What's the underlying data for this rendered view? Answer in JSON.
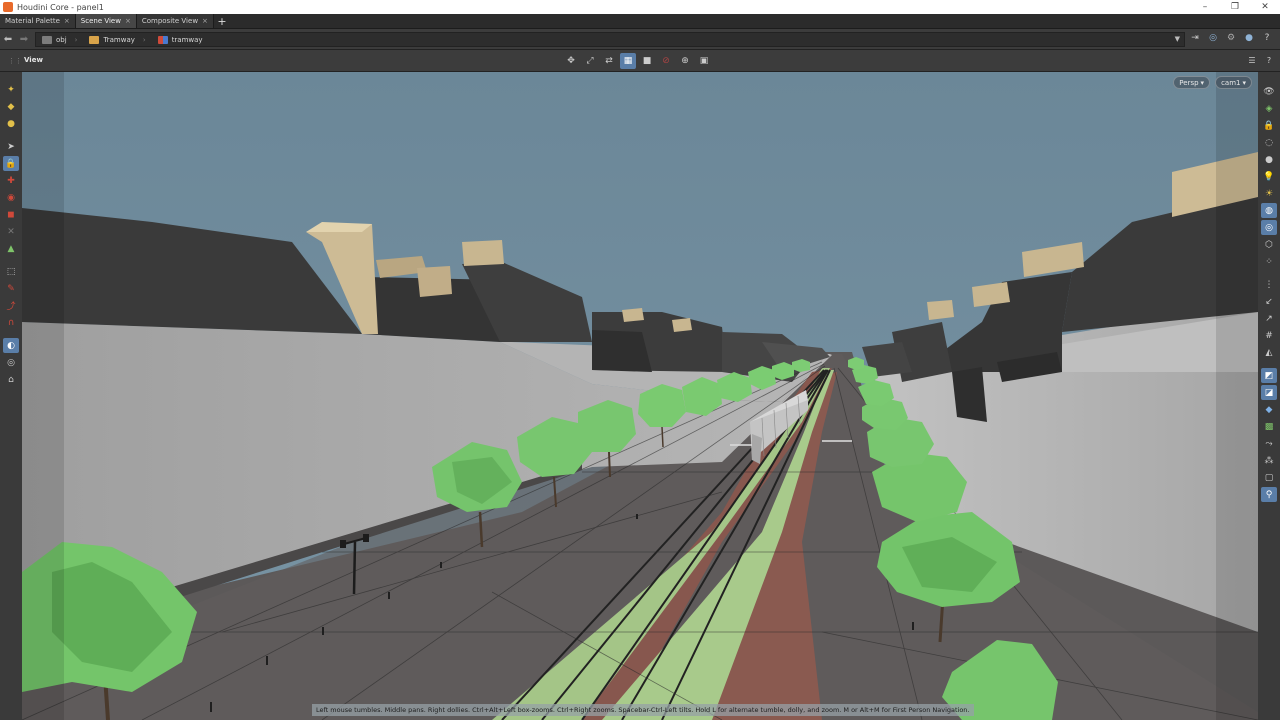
{
  "window": {
    "title": "Houdini Core - panel1",
    "controls": [
      "–",
      "❐",
      "✕"
    ]
  },
  "tabs": [
    {
      "label": "Material Palette",
      "active": false
    },
    {
      "label": "Scene View",
      "active": true
    },
    {
      "label": "Composite View",
      "active": false
    }
  ],
  "path": {
    "crumbs": [
      {
        "label": "obj",
        "icon": "obj-network-icon"
      },
      {
        "label": "Tramway",
        "icon": "folder-icon"
      },
      {
        "label": "tramway",
        "icon": "geometry-node-icon"
      }
    ]
  },
  "pane": {
    "title": "View"
  },
  "viewport": {
    "camera_mode": "Persp",
    "camera_name": "cam1",
    "status_hint": "Left mouse tumbles. Middle pans. Right dollies. Ctrl+Alt+Left box-zooms. Ctrl+Right zooms. Spacebar-Ctrl-Left tilts. Hold L for alternate tumble, dolly, and zoom.      M or Alt+M for First Person Navigation."
  },
  "colors": {
    "sky": "#6e8a9c",
    "accent": "#5a7ea8",
    "wall": "#a9a9a9",
    "roof": "#3b3b3b",
    "ground": "#5e5b5b",
    "tram_lane": "#a7c98a",
    "brick_lane": "#8a5a50",
    "tree": "#6fc36a"
  }
}
